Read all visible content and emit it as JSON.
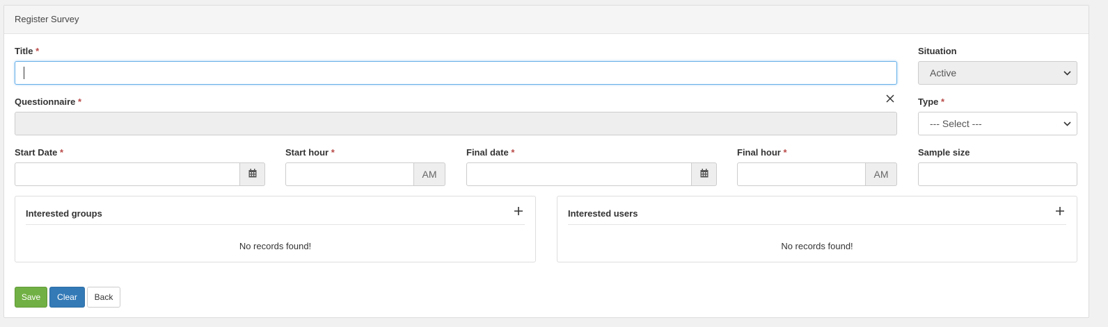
{
  "header": {
    "title": "Register Survey"
  },
  "form": {
    "title_label": "Title",
    "title_value": "",
    "situation_label": "Situation",
    "situation_value": "Active",
    "questionnaire_label": "Questionnaire",
    "questionnaire_value": "",
    "type_label": "Type",
    "type_value": "--- Select ---",
    "start_date_label": "Start Date",
    "start_hour_label": "Start hour",
    "start_hour_suffix": "AM",
    "final_date_label": "Final date",
    "final_hour_label": "Final hour",
    "final_hour_suffix": "AM",
    "sample_size_label": "Sample size",
    "required_marker": "*"
  },
  "groups": {
    "title": "Interested groups",
    "empty": "No records found!",
    "add_icon": "+"
  },
  "users": {
    "title": "Interested users",
    "empty": "No records found!",
    "add_icon": "+"
  },
  "buttons": {
    "save": "Save",
    "clear": "Clear",
    "back": "Back"
  },
  "icons": {
    "clear": "✕",
    "chevron": "⌄",
    "calendar": "calendar-icon"
  },
  "colors": {
    "save": "#71b044",
    "clear": "#337ab7",
    "required": "#b94a48",
    "focus": "#66afe9"
  }
}
